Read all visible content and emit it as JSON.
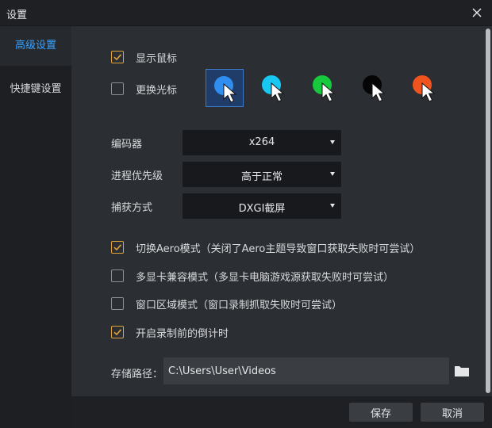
{
  "window": {
    "title": "设置"
  },
  "sidebar": {
    "items": [
      {
        "label": "高级设置",
        "active": true
      },
      {
        "label": "快捷键设置",
        "active": false
      }
    ]
  },
  "options": {
    "show_mouse": {
      "label": "显示鼠标",
      "checked": true
    },
    "change_cursor": {
      "label": "更换光标",
      "checked": false
    },
    "aero_mode": {
      "label": "切换Aero模式（关闭了Aero主题导致窗口获取失败时可尝试）",
      "checked": true
    },
    "multi_gpu": {
      "label": "多显卡兼容模式（多显卡电脑游戏源获取失败时可尝试）",
      "checked": false
    },
    "window_region": {
      "label": "窗口区域模式（窗口录制抓取失败时可尝试）",
      "checked": false
    },
    "countdown": {
      "label": "开启录制前的倒计时",
      "checked": true
    }
  },
  "cursor_styles": [
    {
      "name": "blue",
      "color": "#2f8ef0",
      "selected": true
    },
    {
      "name": "cyan",
      "color": "#19c8f2",
      "selected": false
    },
    {
      "name": "green",
      "color": "#17c93c",
      "selected": false
    },
    {
      "name": "black",
      "color": "#050505",
      "selected": false
    },
    {
      "name": "orange",
      "color": "#f0541e",
      "selected": false
    }
  ],
  "encoder": {
    "label": "编码器",
    "value": "x264"
  },
  "priority": {
    "label": "进程优先级",
    "value": "高于正常"
  },
  "capture": {
    "label": "捕获方式",
    "value": "DXGI截屏"
  },
  "storage": {
    "label": "存储路径：",
    "value": "C:\\Users\\User\\Videos"
  },
  "footer": {
    "save_label": "保存",
    "cancel_label": "取消"
  },
  "colors": {
    "accent": "#3aa3ff",
    "check": "#e2a23b",
    "background": "#2b2e33",
    "sidebar": "#1d1f23"
  }
}
